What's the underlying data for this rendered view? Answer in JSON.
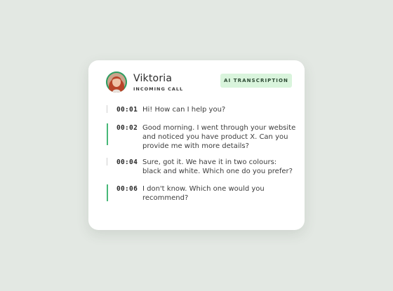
{
  "contact": {
    "name": "Viktoria",
    "status": "INCOMING CALL"
  },
  "badge": "AI TRANSCRIPTION",
  "colors": {
    "background": "#e3e8e3",
    "accent_green": "#48b878",
    "badge_bg": "#d9f4dc"
  },
  "messages": [
    {
      "time": "00:01",
      "text": "Hi! How can I help you?",
      "active": false
    },
    {
      "time": "00:02",
      "text": "Good morning. I went through your website and noticed you have product X. Can you provide me with more details?",
      "active": true
    },
    {
      "time": "00:04",
      "text": "Sure, got it. We have it in two colours: black and white. Which one do you prefer?",
      "active": false
    },
    {
      "time": "00:06",
      "text": "I don't know. Which one would you recommend?",
      "active": true
    }
  ]
}
